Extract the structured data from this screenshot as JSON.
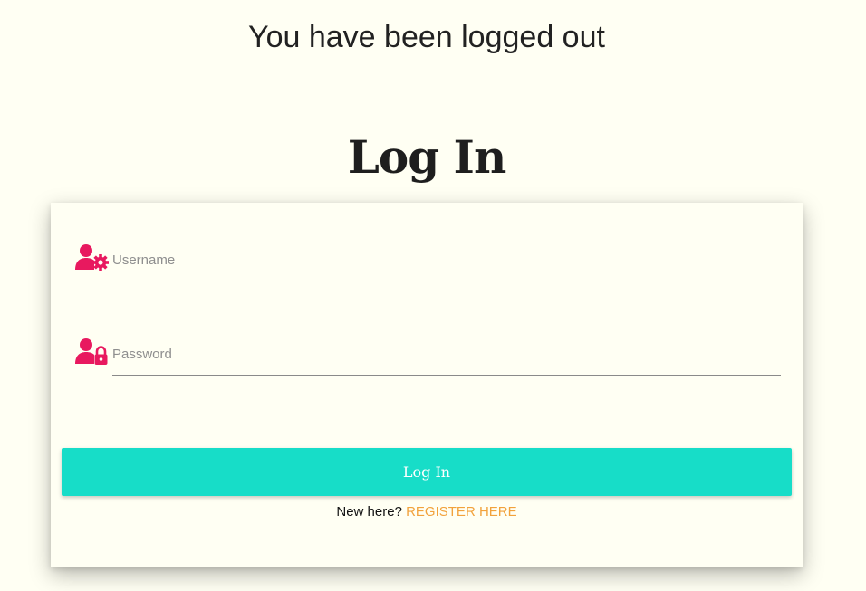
{
  "status_message": "You have been logged out",
  "page_title": "Log In",
  "form": {
    "username": {
      "placeholder": "Username",
      "value": "",
      "icon": "user-gear-icon"
    },
    "password": {
      "placeholder": "Password",
      "value": "",
      "icon": "user-lock-icon"
    },
    "submit_label": "Log In",
    "register_prompt": "New here?",
    "register_link_label": "REGISTER HERE"
  },
  "colors": {
    "background": "#fffff3",
    "icon": "#e8195f",
    "button": "#17ddc8",
    "link": "#f2a23c"
  }
}
